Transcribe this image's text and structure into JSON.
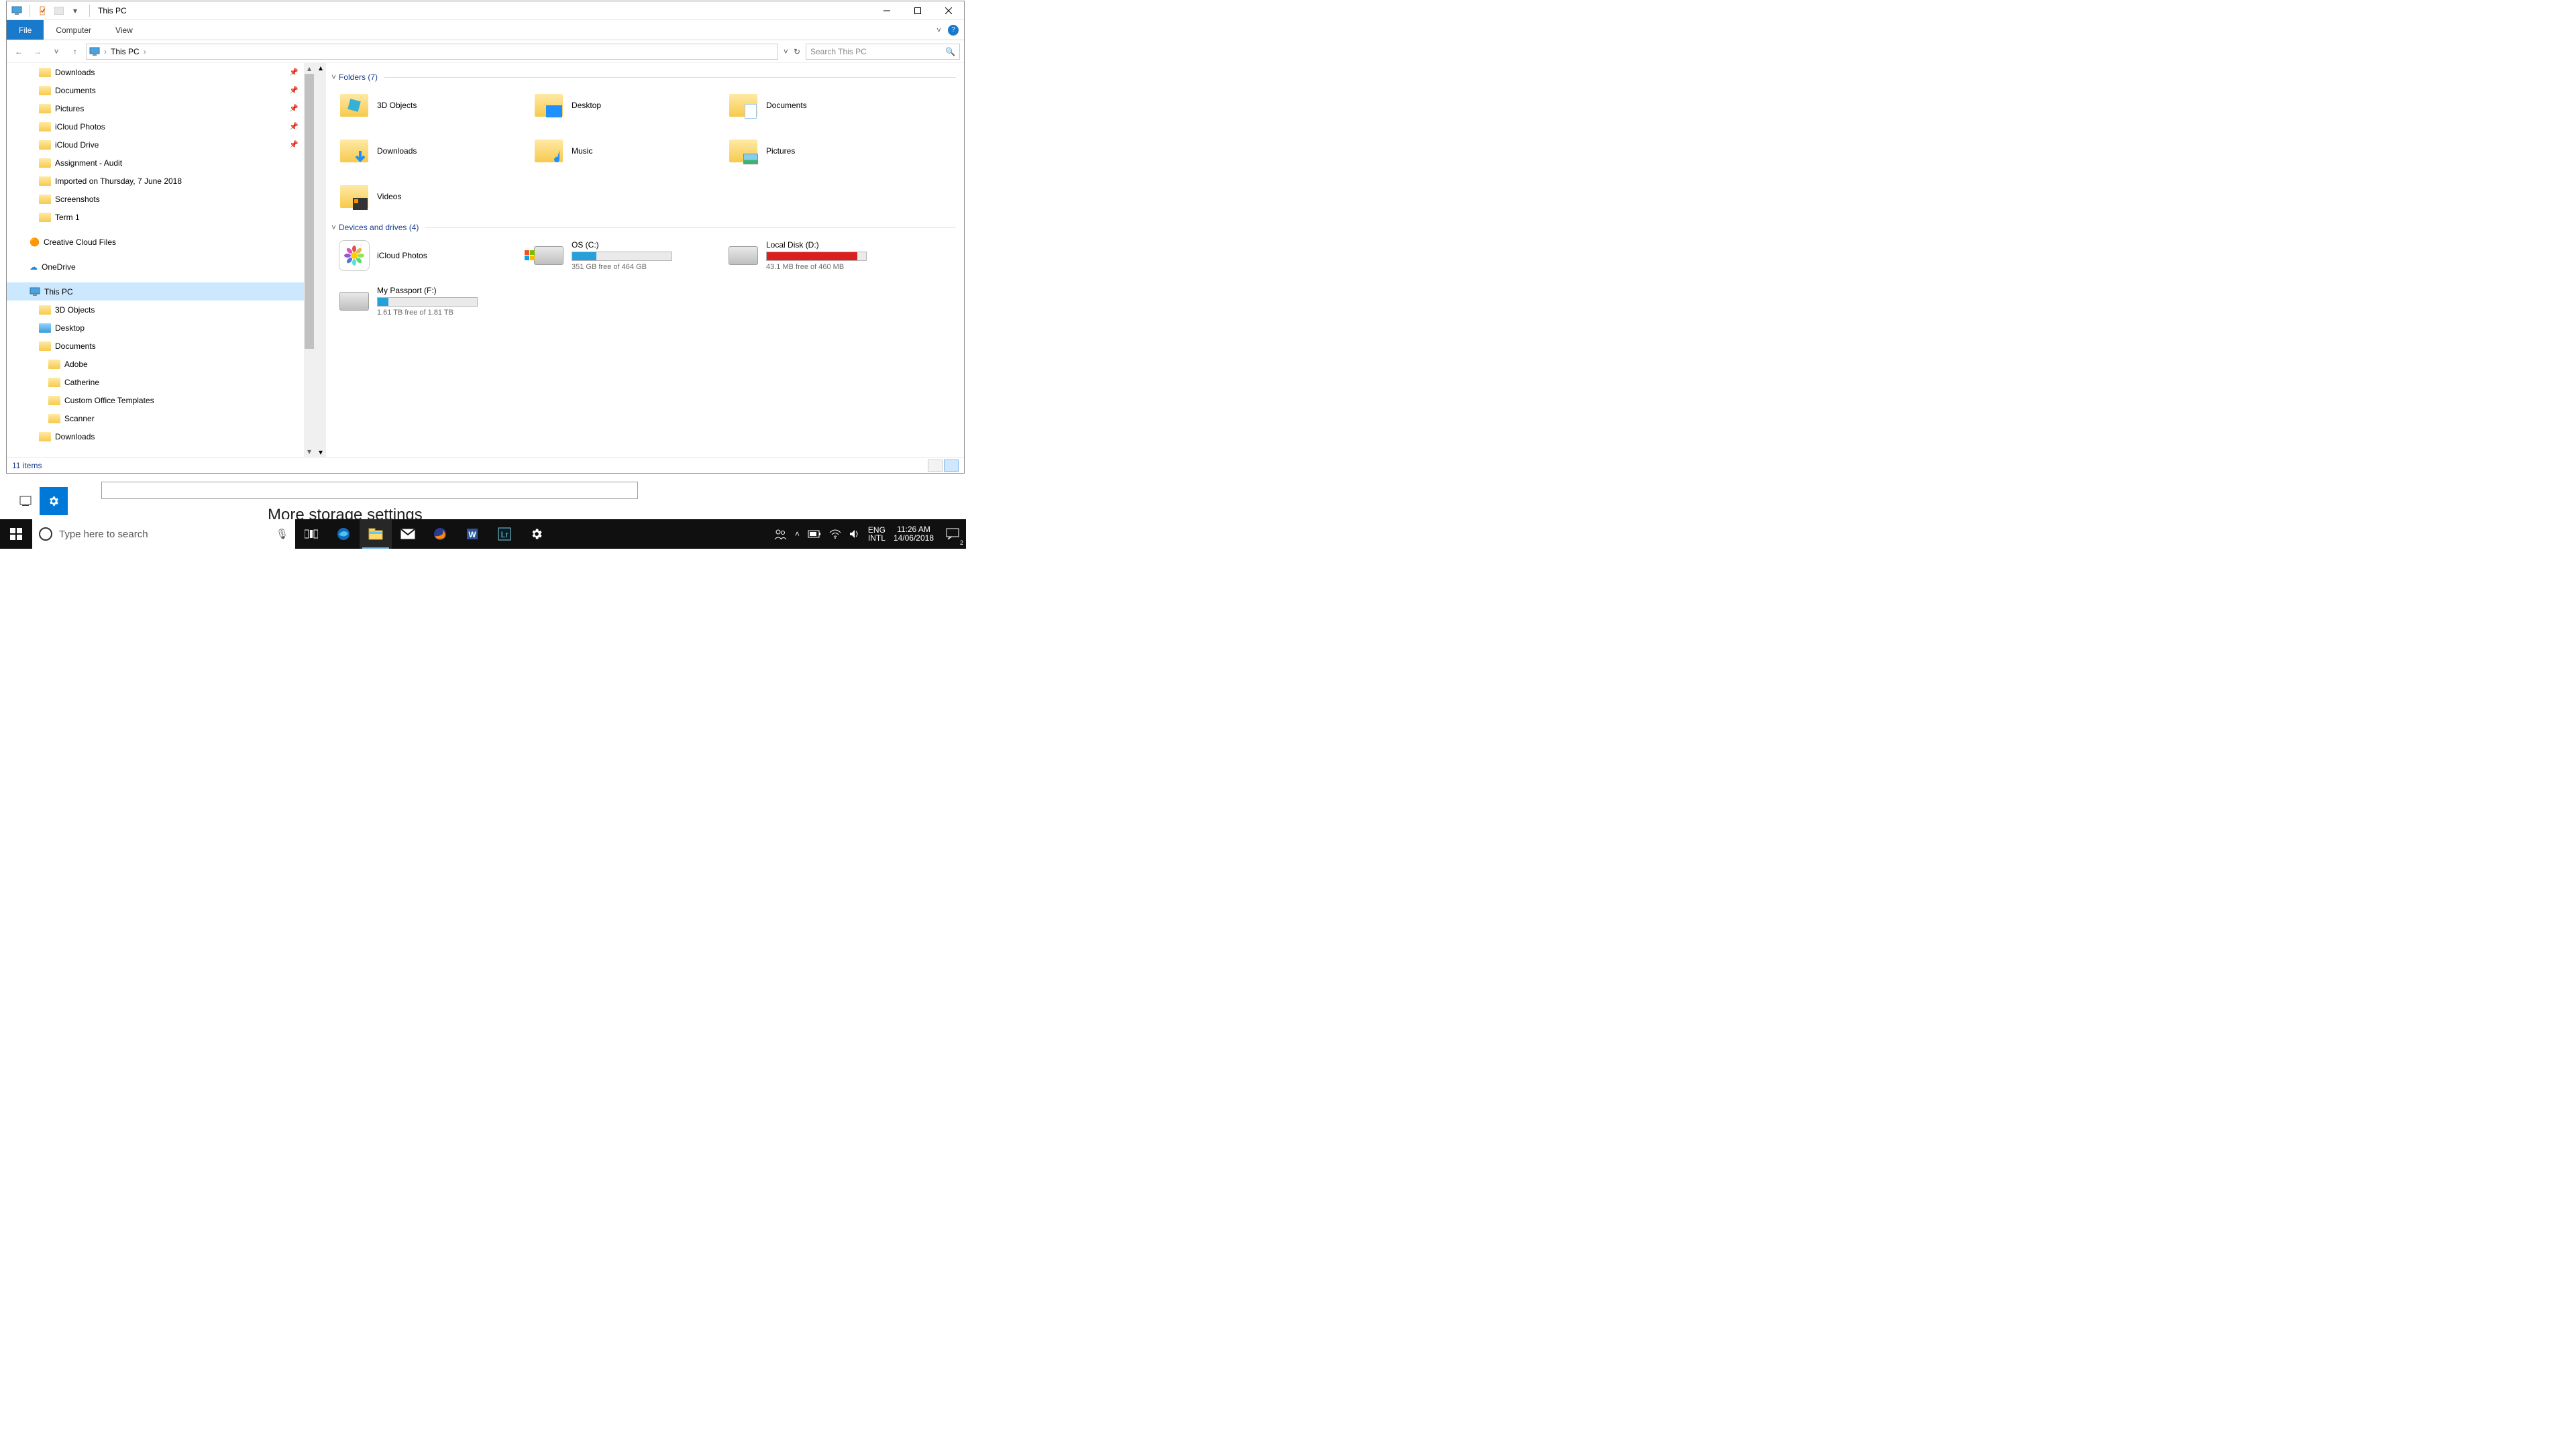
{
  "window": {
    "title": "This PC"
  },
  "ribbon": {
    "file": "File",
    "computer": "Computer",
    "view": "View"
  },
  "address": {
    "location": "This PC"
  },
  "search": {
    "placeholder": "Search This PC"
  },
  "nav": {
    "quick": [
      {
        "label": "Downloads",
        "pinned": true
      },
      {
        "label": "Documents",
        "pinned": true
      },
      {
        "label": "Pictures",
        "pinned": true
      },
      {
        "label": "iCloud Photos",
        "pinned": true
      },
      {
        "label": "iCloud Drive",
        "pinned": true
      },
      {
        "label": "Assignment - Audit",
        "pinned": false
      },
      {
        "label": "Imported on Thursday, 7 June 2018",
        "pinned": false
      },
      {
        "label": "Screenshots",
        "pinned": false
      },
      {
        "label": "Term 1",
        "pinned": false
      }
    ],
    "creative": "Creative Cloud Files",
    "onedrive": "OneDrive",
    "thispc": "This PC",
    "pc_children": [
      "3D Objects",
      "Desktop",
      "Documents"
    ],
    "doc_children": [
      "Adobe",
      "Catherine",
      "Custom Office Templates",
      "Scanner"
    ],
    "downloads": "Downloads"
  },
  "groups": {
    "folders": {
      "label": "Folders (7)"
    },
    "drives": {
      "label": "Devices and drives (4)"
    }
  },
  "folders": [
    {
      "label": "3D Objects"
    },
    {
      "label": "Desktop"
    },
    {
      "label": "Documents"
    },
    {
      "label": "Downloads"
    },
    {
      "label": "Music"
    },
    {
      "label": "Pictures"
    },
    {
      "label": "Videos"
    }
  ],
  "drives": [
    {
      "label": "iCloud Photos",
      "free": "",
      "pct": 0,
      "color": "none"
    },
    {
      "label": "OS (C:)",
      "free": "351 GB free of 464 GB",
      "pct": 24,
      "color": "blue"
    },
    {
      "label": "Local Disk (D:)",
      "free": "43.1 MB free of 460 MB",
      "pct": 91,
      "color": "red"
    },
    {
      "label": "My Passport (F:)",
      "free": "1.61 TB free of 1.81 TB",
      "pct": 11,
      "color": "blue"
    }
  ],
  "status": {
    "items": "11 items"
  },
  "under": {
    "heading": "More storage settings"
  },
  "taskbar": {
    "search_placeholder": "Type here to search",
    "locale1": "ENG",
    "locale2": "INTL",
    "time": "11:26 AM",
    "date": "14/06/2018",
    "action_badge": "2"
  }
}
